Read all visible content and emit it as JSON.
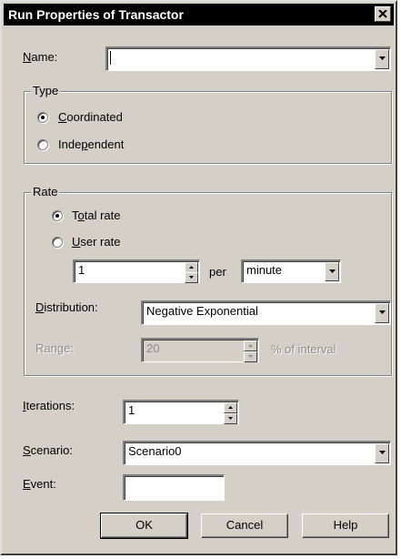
{
  "dialog": {
    "title": "Run Properties of Transactor",
    "close_icon": "close-icon"
  },
  "name": {
    "label_accel": "N",
    "label_rest": "ame:",
    "value": ""
  },
  "type_group": {
    "legend": "Type",
    "options": [
      {
        "accel": "C",
        "rest": "oordinated",
        "selected": true
      },
      {
        "pre": "Inde",
        "accel": "p",
        "rest": "endent",
        "selected": false
      }
    ]
  },
  "rate_group": {
    "legend": "Rate",
    "options": [
      {
        "pre": "T",
        "accel": "o",
        "rest": "tal rate",
        "selected": true
      },
      {
        "accel": "U",
        "rest": "ser rate",
        "selected": false
      }
    ],
    "rate_value": "1",
    "per_label": "per",
    "unit_value": "minute",
    "distribution_label_accel": "D",
    "distribution_label_rest": "istribution:",
    "distribution_value": "Negative Exponential",
    "range_label": "Range:",
    "range_value": "20",
    "range_suffix": "% of interval"
  },
  "iterations": {
    "label_accel": "I",
    "label_rest": "terations:",
    "value": "1"
  },
  "scenario": {
    "label_accel": "S",
    "label_rest": "cenario:",
    "value": "Scenario0"
  },
  "event": {
    "label_accel": "E",
    "label_rest": "vent:",
    "value": ""
  },
  "buttons": {
    "ok": "OK",
    "cancel": "Cancel",
    "help": "Help"
  }
}
